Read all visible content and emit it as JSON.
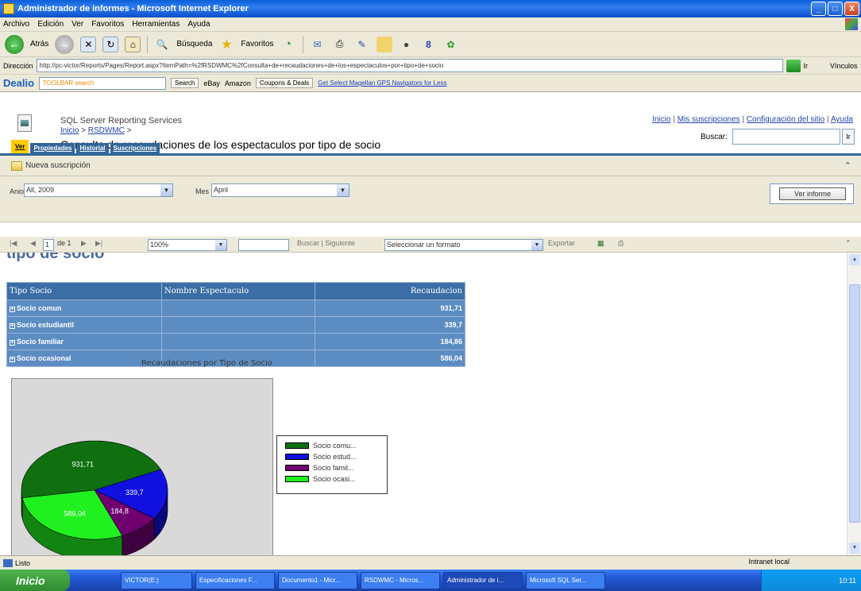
{
  "window": {
    "title": "Administrador de informes - Microsoft Internet Explorer",
    "buttons": [
      "_",
      "□",
      "X"
    ]
  },
  "menu": [
    "Archivo",
    "Edición",
    "Ver",
    "Favoritos",
    "Herramientas",
    "Ayuda"
  ],
  "toolbar": {
    "back_label": "Atrás",
    "search_label": "Búsqueda",
    "favorites_label": "Favoritos"
  },
  "address": {
    "label": "Dirección",
    "url": "http://pc-victor/Reports/Pages/Report.aspx?ItemPath=%2fRSDWMC%2fConsulta+de+recaudaciones+de+los+espectaculos+por+tipo+de+socio",
    "go_label": "Ir",
    "vinculos": "Vínculos"
  },
  "linksbar": {
    "logo": "Dealio",
    "search_placeholder": "TOOLBAR search",
    "search_btn": "Search",
    "ebay": "eBay",
    "amazon": "Amazon",
    "coupons": "Coupons & Deals",
    "magellan": "Get Select Magellan GPS Navigators for Less"
  },
  "rm": {
    "product": "SQL Server Reporting Services",
    "crumb_home": "Inicio",
    "crumb_folder": "RSDWMC",
    "crumb_sep": ">",
    "title": "Consulta de recaudaciones de los espectaculos por tipo de socio",
    "toplinks": {
      "home": "Inicio",
      "subs": "Mis suscripciones",
      "config": "Configuración del sitio",
      "help": "Ayuda"
    },
    "search_label": "Buscar:",
    "search_go": "Ir"
  },
  "tabs": [
    "Ver",
    "Propiedades",
    "Historial",
    "Suscripciones"
  ],
  "subscription": {
    "new_label": "Nueva suscripción"
  },
  "params": {
    "year_label": "Anio",
    "year_value": "All, 2009",
    "month_label": "Mes",
    "month_value": "April",
    "view_report": "Ver informe"
  },
  "report_toolbar": {
    "page_value": "1",
    "page_of": "de 1",
    "zoom": "100%",
    "find_label": "Buscar | Siguiente",
    "format_select": "Seleccionar un formato",
    "export_label": "Exportar"
  },
  "report": {
    "cut_title": "tipo de socio",
    "headers": [
      "Tipo Socio",
      "Nombre Espectaculo",
      "Recaudacion"
    ],
    "rows": [
      {
        "tipo": "Socio comun",
        "nombre": "",
        "recaudacion": "931,71"
      },
      {
        "tipo": "Socio estudiantil",
        "nombre": "",
        "recaudacion": "339,7"
      },
      {
        "tipo": "Socio familiar",
        "nombre": "",
        "recaudacion": "184,86"
      },
      {
        "tipo": "Socio ocasional",
        "nombre": "",
        "recaudacion": "586,04"
      }
    ]
  },
  "chart_data": {
    "type": "pie",
    "title": "Recaudaciones por Tipo de Socio",
    "categories": [
      "Socio comun",
      "Socio estudiantil",
      "Socio familiar",
      "Socio ocasional"
    ],
    "legend_labels": [
      "Socio comu...",
      "Socio estud...",
      "Socio famil...",
      "Socio ocasi..."
    ],
    "values": [
      931.71,
      339.7,
      184.86,
      586.04
    ],
    "data_labels": [
      "931,71",
      "339,7",
      "184,8",
      "586,04"
    ],
    "colors": [
      "#107010",
      "#1010e0",
      "#700070",
      "#20f020"
    ],
    "legend": "right"
  },
  "status": {
    "left": "Listo",
    "zone": "Intranet local"
  },
  "taskbar": {
    "start": "Inicio",
    "tasks": [
      "VICTOR(E:)",
      "Especificaciones F...",
      "Documento1 - Micr...",
      "RSDWMC - Micros...",
      "Administrador de i...",
      "Microsoft SQL Ser..."
    ],
    "clock": "10:11"
  }
}
